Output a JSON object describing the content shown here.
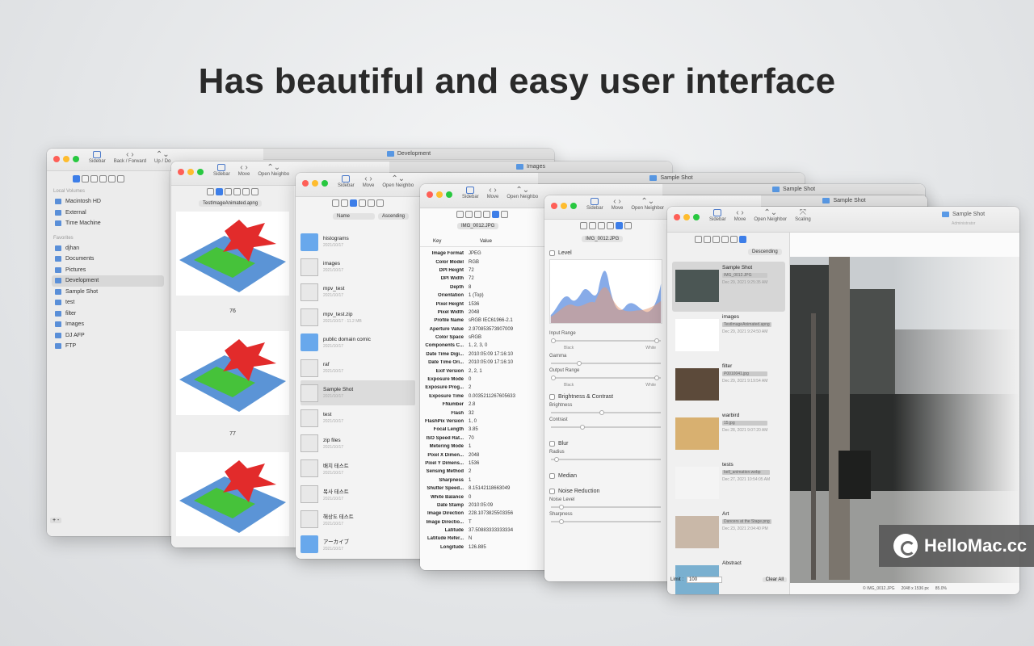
{
  "headline": "Has beautiful and easy user interface",
  "toolbar": {
    "sidebar": "Sidebar",
    "back_forward": "Back / Forward",
    "up_down": "Up / Do",
    "move": "Move",
    "open_neighbor": "Open Neighbo",
    "open_neighbor_full": "Open Neighbor",
    "scaling": "Scaling"
  },
  "w1": {
    "tab": "Development",
    "section_local": "Local Volumes",
    "section_fav": "Favorites",
    "volumes": [
      "Macintosh HD",
      "External",
      "Time Machine"
    ],
    "favorites": [
      "djhan",
      "Documents",
      "Pictures",
      "Development",
      "Sample Shot",
      "test",
      "filter",
      "Images",
      "DJ AFP",
      "FTP"
    ],
    "add": "+ -"
  },
  "w2": {
    "file": "TestImageAnimated.apng",
    "numbers": [
      "76",
      "77"
    ]
  },
  "w3": {
    "tab": "Images",
    "sort_name": "Name",
    "sort_order": "Ascending",
    "rows": [
      {
        "name": "histograms",
        "date": "2021/10/17"
      },
      {
        "name": "images",
        "date": "2021/10/17"
      },
      {
        "name": "mpv_test",
        "date": "2021/10/17"
      },
      {
        "name": "mpv_test.zip",
        "date": "2021/10/17 · 11.2 MB"
      },
      {
        "name": "public domain comic",
        "date": "2021/10/17"
      },
      {
        "name": "raf",
        "date": "2021/10/17"
      },
      {
        "name": "Sample Shot",
        "date": "2021/10/17"
      },
      {
        "name": "test",
        "date": "2021/10/17"
      },
      {
        "name": "zip files",
        "date": "2021/10/17"
      },
      {
        "name": "배치 테스트",
        "date": "2021/10/17"
      },
      {
        "name": "복사 테스트",
        "date": "2021/10/17"
      },
      {
        "name": "해상도 테스트",
        "date": "2021/10/17"
      },
      {
        "name": "アーカイブ",
        "date": "2021/10/17"
      }
    ]
  },
  "w4": {
    "tab": "Sample Shot",
    "file": "IMG_0012.JPG",
    "col_key": "Key",
    "col_value": "Value",
    "rows": [
      [
        "Image Format",
        "JPEG"
      ],
      [
        "Color Model",
        "RGB"
      ],
      [
        "DPI Height",
        "72"
      ],
      [
        "DPI Width",
        "72"
      ],
      [
        "Depth",
        "8"
      ],
      [
        "Orientation",
        "1 (Top)"
      ],
      [
        "Pixel Height",
        "1536"
      ],
      [
        "Pixel Width",
        "2048"
      ],
      [
        "Profile Name",
        "sRGB IEC61966-2.1"
      ],
      [
        "Aperture Value",
        "2.970853573907009"
      ],
      [
        "Color Space",
        "sRGB"
      ],
      [
        "Components C...",
        "1, 2, 3, 0"
      ],
      [
        "Date Time Digi...",
        "2010:05:09 17:16:10"
      ],
      [
        "Date Time Ori...",
        "2010:05:09 17:16:10"
      ],
      [
        "Exif Version",
        "2, 2, 1"
      ],
      [
        "Exposure Mode",
        "0"
      ],
      [
        "Exposure Prog...",
        "2"
      ],
      [
        "Exposure Time",
        "0.0035211267605633"
      ],
      [
        "FNumber",
        "2.8"
      ],
      [
        "Flash",
        "32"
      ],
      [
        "FlashPix Version",
        "1, 0"
      ],
      [
        "Focal Length",
        "3.85"
      ],
      [
        "ISO Speed Rat...",
        "70"
      ],
      [
        "Metering Mode",
        "1"
      ],
      [
        "Pixel X Dimen...",
        "2048"
      ],
      [
        "Pixel Y Dimens...",
        "1536"
      ],
      [
        "Sensing Method",
        "2"
      ],
      [
        "Sharpness",
        "1"
      ],
      [
        "Shutter Speed...",
        "8.15142118663049"
      ],
      [
        "White Balance",
        "0"
      ],
      [
        "Date Stamp",
        "2010:05:09"
      ],
      [
        "Image Direction",
        "228.1073825503356"
      ],
      [
        "Image Directio...",
        "T"
      ],
      [
        "Latitude",
        "37.50883333333334"
      ],
      [
        "Latitude Refer...",
        "N"
      ],
      [
        "Longitude",
        "126.885"
      ]
    ]
  },
  "w5": {
    "tab": "Sample Shot",
    "file": "IMG_0012.JPG",
    "level": "Level",
    "input_range": "Input Range",
    "black": "Black",
    "white": "White",
    "gamma": "Gamma",
    "output_range": "Output Range",
    "brightness_contrast": "Brightness & Contrast",
    "brightness": "Brightness",
    "contrast": "Contrast",
    "blur": "Blur",
    "radius": "Radius",
    "median": "Median",
    "noise_reduction": "Noise Reduction",
    "noise_level": "Noise Level",
    "sharpness": "Sharpness"
  },
  "w6": {
    "tab": "Sample Shot",
    "title": "Sample Shot",
    "subtitle": "Administrator",
    "sort": "Descending",
    "items": [
      {
        "name": "Sample Shot",
        "file": "IMG_0012.JPG",
        "date": "Dec 29, 2021 9:25:35 AM"
      },
      {
        "name": "images",
        "file": "TestImageAnimated.apng",
        "date": "Dec 29, 2021 9:24:50 AM"
      },
      {
        "name": "filter",
        "file": "P0010041.jpg",
        "date": "Dec 29, 2021 9:19:54 AM"
      },
      {
        "name": "warbird",
        "file": "15.jpg",
        "date": "Dec 28, 2021 9:07:20 AM"
      },
      {
        "name": "tests",
        "file": "bell_animation.webp",
        "date": "Dec 27, 2021 10:54:05 AM"
      },
      {
        "name": "Art",
        "file": "Dancers at the Stage.png",
        "date": "Dec 23, 2021 2:04:40 PM"
      },
      {
        "name": "Abstract",
        "file": "",
        "date": ""
      }
    ],
    "limit_label": "Limit :",
    "limit_value": "100",
    "clear_all": "Clear All",
    "status_file": "© IMG_0012.JPG",
    "status_size": "2048 x 1536 px",
    "status_zoom": "85.0%"
  },
  "watermark": "HelloMac.cc",
  "colors": {
    "accent": "#3d7ee8",
    "folder": "#68a8ec"
  }
}
